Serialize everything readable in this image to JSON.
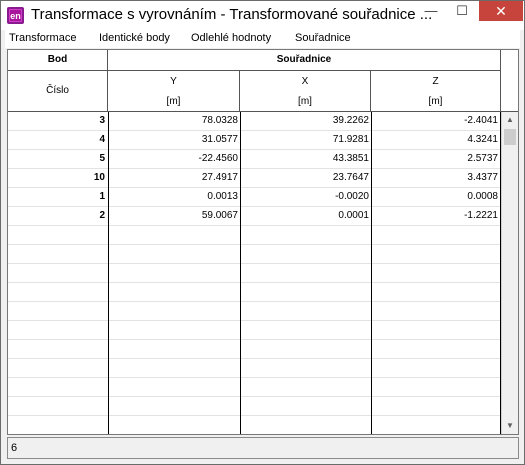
{
  "window": {
    "title": "Transformace s vyrovnáním - Transformované souřadnice ...",
    "app_icon_text": "en",
    "controls": {
      "minimize": "—",
      "maximize": "☐",
      "close": "✕"
    }
  },
  "menu": {
    "items": [
      "Transformace",
      "Identické body",
      "Odlehlé hodnoty",
      "Souřadnice"
    ]
  },
  "table": {
    "group_headers": {
      "bod": "Bod",
      "coords": "Souřadnice"
    },
    "sub_headers": {
      "cislo": "Číslo",
      "y": "Y",
      "x": "X",
      "z": "Z",
      "y_unit": "[m]",
      "x_unit": "[m]",
      "z_unit": "[m]"
    },
    "rows": [
      {
        "bod": "3",
        "y": "78.0328",
        "x": "39.2262",
        "z": "-2.4041"
      },
      {
        "bod": "4",
        "y": "31.0577",
        "x": "71.9281",
        "z": "4.3241"
      },
      {
        "bod": "5",
        "y": "-22.4560",
        "x": "43.3851",
        "z": "2.5737"
      },
      {
        "bod": "10",
        "y": "27.4917",
        "x": "23.7647",
        "z": "3.4377"
      },
      {
        "bod": "1",
        "y": "0.0013",
        "x": "-0.0020",
        "z": "0.0008"
      },
      {
        "bod": "2",
        "y": "59.0067",
        "x": "0.0001",
        "z": "-1.2221"
      }
    ]
  },
  "scrollbar": {
    "up_icon": "▲",
    "down_icon": "▼"
  },
  "status": {
    "text": "6"
  }
}
